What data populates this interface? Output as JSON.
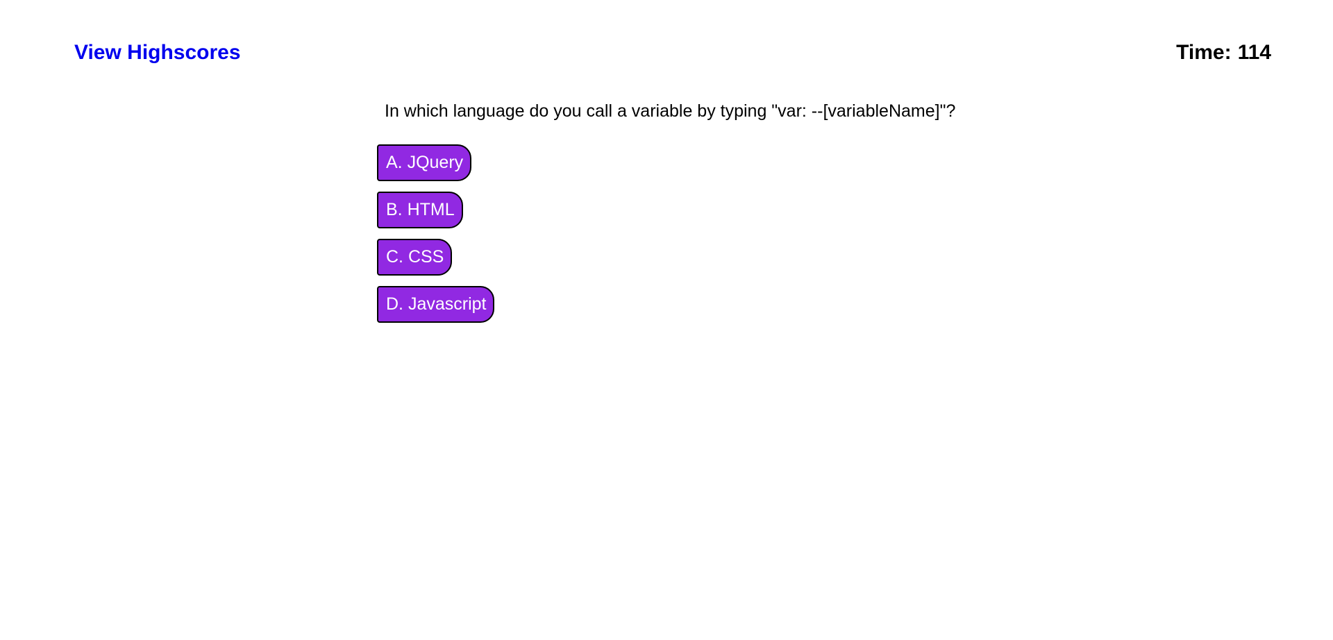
{
  "header": {
    "highscores_link": "View Highscores",
    "timer_label": "Time:",
    "timer_value": "114"
  },
  "quiz": {
    "question": "In which language do you call a variable by typing \"var: --[variableName]\"?",
    "answers": [
      {
        "label": "A. JQuery"
      },
      {
        "label": "B. HTML"
      },
      {
        "label": "C. CSS"
      },
      {
        "label": "D. Javascript"
      }
    ]
  },
  "colors": {
    "link": "#0000ee",
    "answer_background": "#9129e2",
    "answer_text": "#ffffff",
    "answer_border": "#000000"
  }
}
